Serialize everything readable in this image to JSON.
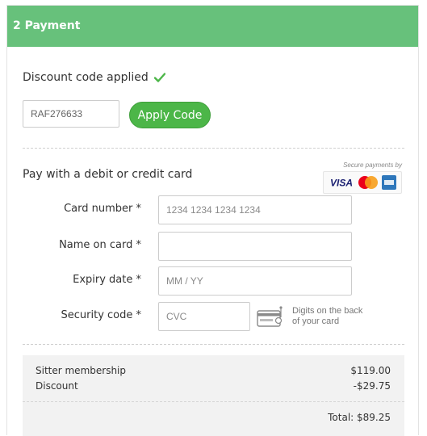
{
  "header": {
    "title": "2 Payment"
  },
  "discount": {
    "applied_label": "Discount code applied",
    "code_value": "RAF276633",
    "apply_button_label": "Apply Code"
  },
  "card": {
    "section_label": "Pay with a debit or credit card",
    "secure_text": "Secure payments by",
    "logos": [
      "visa-logo",
      "mastercard-logo",
      "amex-logo"
    ],
    "fields": {
      "number": {
        "label": "Card number *",
        "placeholder": "1234 1234 1234 1234",
        "value": ""
      },
      "name": {
        "label": "Name on card *",
        "placeholder": "",
        "value": ""
      },
      "expiry": {
        "label": "Expiry date *",
        "placeholder": "MM / YY",
        "value": ""
      },
      "cvc": {
        "label": "Security code *",
        "placeholder": "CVC",
        "value": ""
      }
    },
    "cvc_help": "Digits on the back of your card"
  },
  "summary": {
    "rows": [
      {
        "label": "Sitter membership",
        "amount": "$119.00"
      },
      {
        "label": "Discount",
        "amount": "-$29.75"
      }
    ],
    "total": "Total: $89.25"
  },
  "colors": {
    "header_bg": "#67c17b",
    "button_bg": "#4cb648",
    "check": "#4cb648",
    "summary_bg": "#f2f2f2"
  }
}
